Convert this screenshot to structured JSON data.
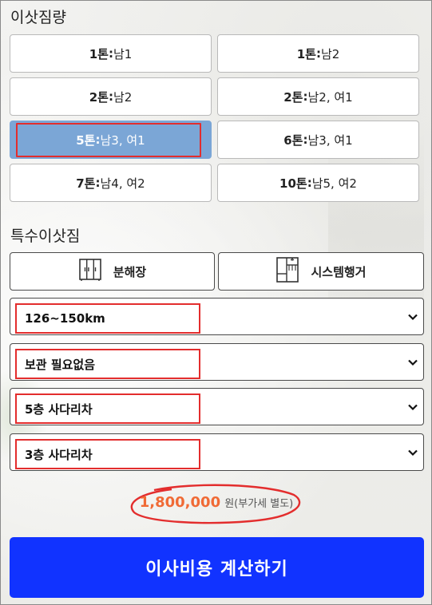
{
  "volume_section": {
    "title": "이삿짐량",
    "options": [
      {
        "ton": "1톤",
        "sep": " : ",
        "workers": "남1"
      },
      {
        "ton": "1톤",
        "sep": " : ",
        "workers": "남2"
      },
      {
        "ton": "2톤",
        "sep": " : ",
        "workers": "남2"
      },
      {
        "ton": "2톤",
        "sep": ": ",
        "workers": "남2, 여1"
      },
      {
        "ton": "5톤",
        "sep": " : ",
        "workers": "남3, 여1"
      },
      {
        "ton": "6톤",
        "sep": " : ",
        "workers": "남3, 여1"
      },
      {
        "ton": "7톤",
        "sep": " : ",
        "workers": "남4, 여2"
      },
      {
        "ton": "10톤",
        "sep": " : ",
        "workers": "남5, 여2"
      }
    ],
    "selected_index": 4
  },
  "special_section": {
    "title": "특수이삿짐",
    "buttons": [
      {
        "label": "분해장",
        "icon": "wardrobe-icon"
      },
      {
        "label": "시스템행거",
        "icon": "system-hanger-icon"
      }
    ]
  },
  "selects": {
    "distance": "126~150km",
    "storage": "보관 필요없음",
    "origin_ladder": "5층 사다리차",
    "dest_ladder": "3층 사다리차"
  },
  "price": {
    "amount": "1,800,000",
    "suffix": "원(부가세 별도)"
  },
  "cta": {
    "label": "이사비용 계산하기"
  },
  "colors": {
    "selected_option": "#7ba6d6",
    "highlight_red": "#e32d2d",
    "price_orange": "#f06a35",
    "cta_blue": "#1133ff"
  }
}
